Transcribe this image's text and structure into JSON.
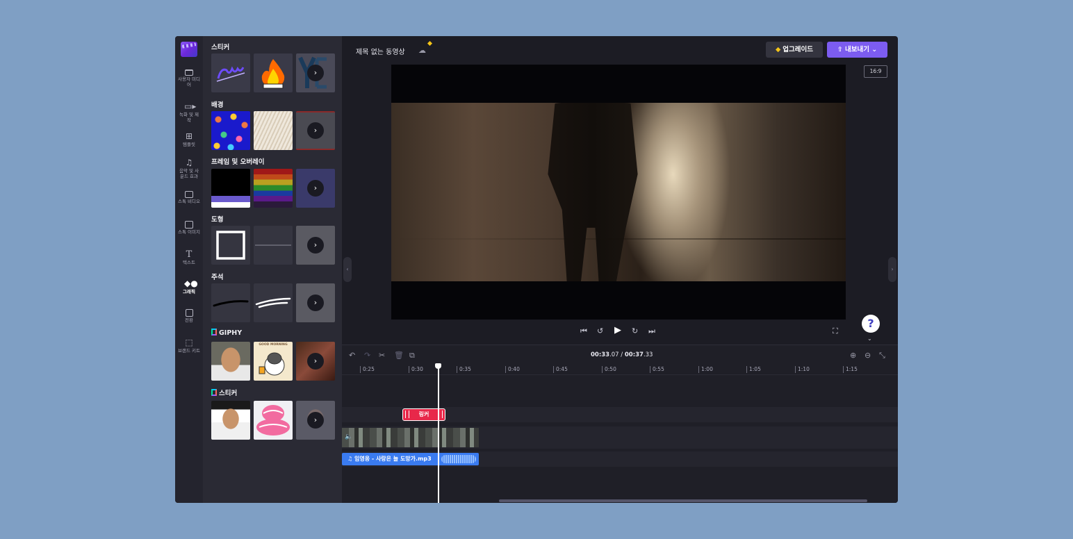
{
  "rail": {
    "items": [
      {
        "label": "사용자 미디어",
        "icon": "folder-icon"
      },
      {
        "label": "녹화 및 제작",
        "icon": "video-camera-icon"
      },
      {
        "label": "템플릿",
        "icon": "template-icon"
      },
      {
        "label": "음악 및 사운드 효과",
        "icon": "music-note-icon"
      },
      {
        "label": "스톡 비디오",
        "icon": "film-icon"
      },
      {
        "label": "스톡 이미지",
        "icon": "image-icon"
      },
      {
        "label": "텍스트",
        "icon": "text-icon"
      },
      {
        "label": "그래픽",
        "icon": "shapes-icon"
      },
      {
        "label": "전환",
        "icon": "transition-icon"
      },
      {
        "label": "브랜드 키트",
        "icon": "brand-kit-icon"
      }
    ],
    "active": "그래픽"
  },
  "library": {
    "sections": [
      {
        "title": "스티커"
      },
      {
        "title": "배경"
      },
      {
        "title": "프레임 및 오버레이"
      },
      {
        "title": "도형"
      },
      {
        "title": "주석"
      },
      {
        "title": "GIPHY"
      },
      {
        "title": "스티커"
      }
    ],
    "thumb_texts": {
      "good_morning": "GOOD MORNING"
    }
  },
  "header": {
    "title": "제목 없는 동영상",
    "upgrade_label": "업그레이드",
    "export_label": "내보내기",
    "aspect_ratio": "16:9"
  },
  "timeline": {
    "current_time_main": "00:33",
    "current_time_frac": ".07",
    "separator": " / ",
    "total_time_main": "00:37",
    "total_time_frac": ".33",
    "ticks": [
      "0:25",
      "0:30",
      "0:35",
      "0:40",
      "0:45",
      "0:50",
      "0:55",
      "1:00",
      "1:05",
      "1:10",
      "1:15"
    ],
    "sticker_clip_label": "링커",
    "audio_clip_label": "임영웅 - 사랑은 늘 도망가.mp3"
  },
  "help": {
    "label": "?"
  },
  "colors": {
    "accent": "#7c5cf0",
    "sticker_clip": "#e8284a",
    "audio_clip": "#3a7bf0",
    "gem": "#f5c518"
  }
}
